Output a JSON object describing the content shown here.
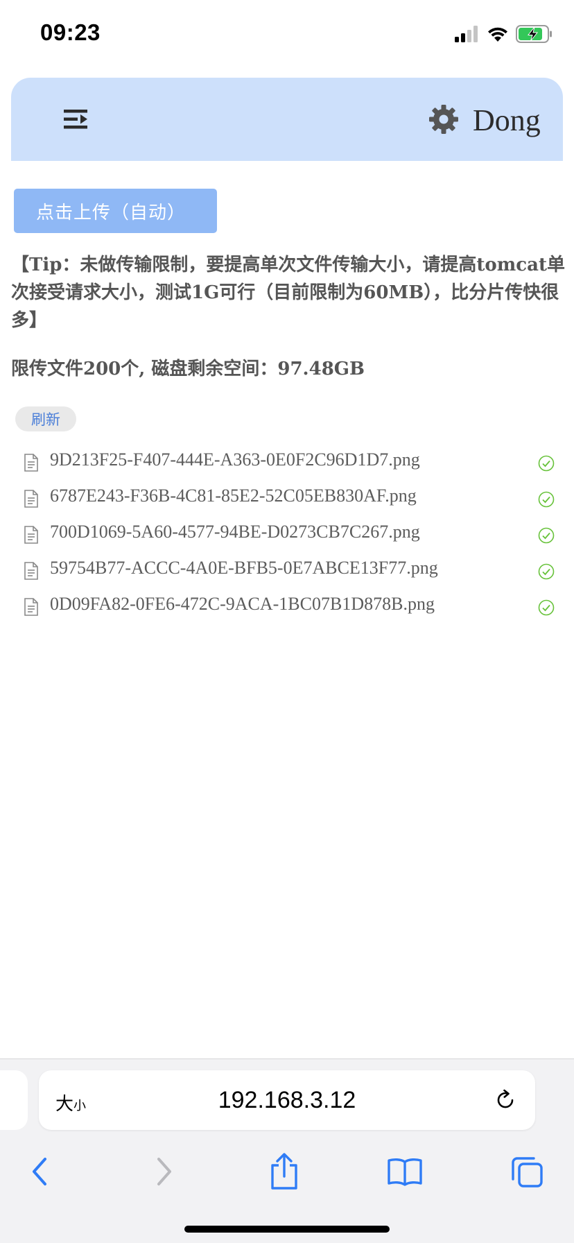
{
  "status_bar": {
    "time": "09:23"
  },
  "header": {
    "user_name": "Dong"
  },
  "upload": {
    "button_label": "点击上传（自动）"
  },
  "tip": "【Tip：未做传输限制，要提高单次文件传输大小，请提高tomcat单次接受请求大小，测试1G可行（目前限制为60MB），比分片传快很多】",
  "limit_info": "限传文件200个, 磁盘剩余空间：97.48GB",
  "refresh": {
    "label": "刷新"
  },
  "files": [
    {
      "name": "9D213F25-F407-444E-A363-0E0F2C96D1D7.png",
      "status": "uploaded"
    },
    {
      "name": "6787E243-F36B-4C81-85E2-52C05EB830AF.png",
      "status": "uploaded"
    },
    {
      "name": "700D1069-5A60-4577-94BE-D0273CB7C267.png",
      "status": "uploaded"
    },
    {
      "name": "59754B77-ACCC-4A0E-BFB5-0E7ABCE13F77.png",
      "status": "uploaded"
    },
    {
      "name": "0D09FA82-0FE6-472C-9ACA-1BC07B1D878B.png",
      "status": "uploaded"
    }
  ],
  "browser": {
    "text_size_big": "大",
    "text_size_small": "小",
    "url": "192.168.3.12"
  },
  "colors": {
    "header_bg": "#cde0fb",
    "upload_button_bg": "#8fb8f5",
    "success_green": "#67c23a",
    "link_blue": "#4a7ed8",
    "system_blue": "#2f7cf6"
  },
  "icons": {
    "menu": "menu-fold-icon",
    "settings": "gear-icon",
    "file": "document-icon",
    "status": "check-circle-icon",
    "reload": "reload-icon",
    "back": "chevron-left-icon",
    "forward": "chevron-right-icon",
    "share": "share-icon",
    "bookmarks": "book-icon",
    "tabs": "tabs-icon"
  }
}
